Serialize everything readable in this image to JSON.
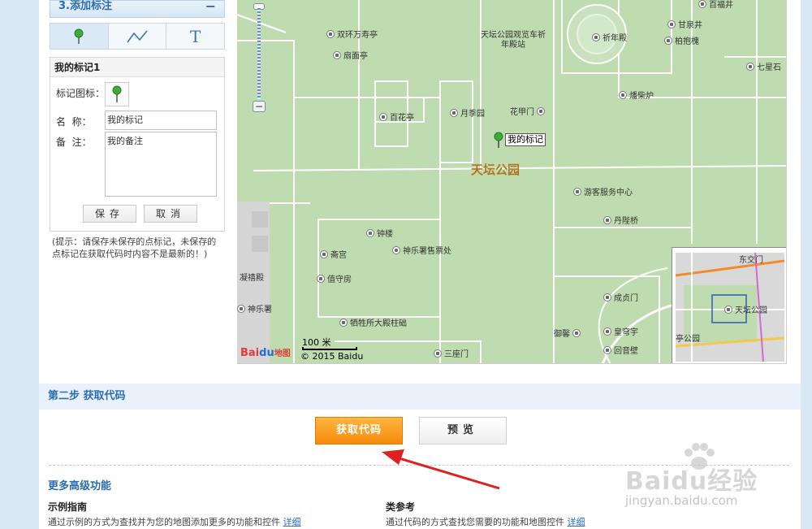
{
  "panel": {
    "title": "3.添加标注",
    "collapse_symbol": "−",
    "tools": [
      {
        "name": "point",
        "icon": "map-pin-icon"
      },
      {
        "name": "line",
        "icon": "polyline-icon"
      },
      {
        "name": "text",
        "icon": "text-icon",
        "glyph": "T"
      }
    ]
  },
  "marker_form": {
    "title": "我的标记1",
    "icon_label": "标记图标：",
    "name_label": "名  称：",
    "name_value": "我的标记",
    "note_label": "备  注：",
    "note_value": "我的备注",
    "save_label": "保存",
    "cancel_label": "取消"
  },
  "tip": "(提示：请保存未保存的点标记，未保存的点标记在获取代码时内容不是最新的！)",
  "map": {
    "park_name": "天坛公园",
    "marker_label": "我的标记",
    "pois": [
      {
        "text": "双环万寿亭"
      },
      {
        "text": "扇面亭"
      },
      {
        "text": "天坛公园观览车祈年殿站"
      },
      {
        "text": "祈年殿"
      },
      {
        "text": "甘泉井"
      },
      {
        "text": "柏抱槐"
      },
      {
        "text": "七星石"
      },
      {
        "text": "百花亭"
      },
      {
        "text": "月季园"
      },
      {
        "text": "花甲门"
      },
      {
        "text": "燔柴炉"
      },
      {
        "text": "游客服务中心"
      },
      {
        "text": "丹陛桥"
      },
      {
        "text": "钟楼"
      },
      {
        "text": "斋宫"
      },
      {
        "text": "神乐署售票处"
      },
      {
        "text": "值守房"
      },
      {
        "text": "凝禧殿"
      },
      {
        "text": "神乐署"
      },
      {
        "text": "牺牲所大殿柱础"
      },
      {
        "text": "成贞门"
      },
      {
        "text": "皇穹宇"
      },
      {
        "text": "回音壁"
      },
      {
        "text": "三座门"
      },
      {
        "text": "御馨"
      },
      {
        "text": "百福井"
      }
    ],
    "scale_label": "100 米",
    "logo_text_a": "Bai",
    "logo_text_b": "du",
    "logo_text_c": "地图",
    "copyright": "© 2015 Baidu",
    "overview": {
      "labels": [
        "天坛公园",
        "亭公园",
        "东交门"
      ]
    }
  },
  "step2": {
    "title": "第二步 获取代码",
    "get_code_label": "获取代码",
    "preview_label": "预览"
  },
  "more": {
    "title": "更多高级功能",
    "col1_title": "示例指南",
    "col1_desc": "通过示例的方式为查找并为您的地图添加更多的功能和控件",
    "col1_link": "详细",
    "col2_title": "类参考",
    "col2_desc": "通过代码的方式查找您需要的功能和地图控件",
    "col2_link": "详细"
  },
  "watermark": {
    "text": "Baidu经验",
    "url": "jingyan.baidu.com"
  },
  "colors": {
    "accent": "#2b6cb0",
    "orange": "#f58a0a",
    "map_green": "#bfdcb0"
  }
}
